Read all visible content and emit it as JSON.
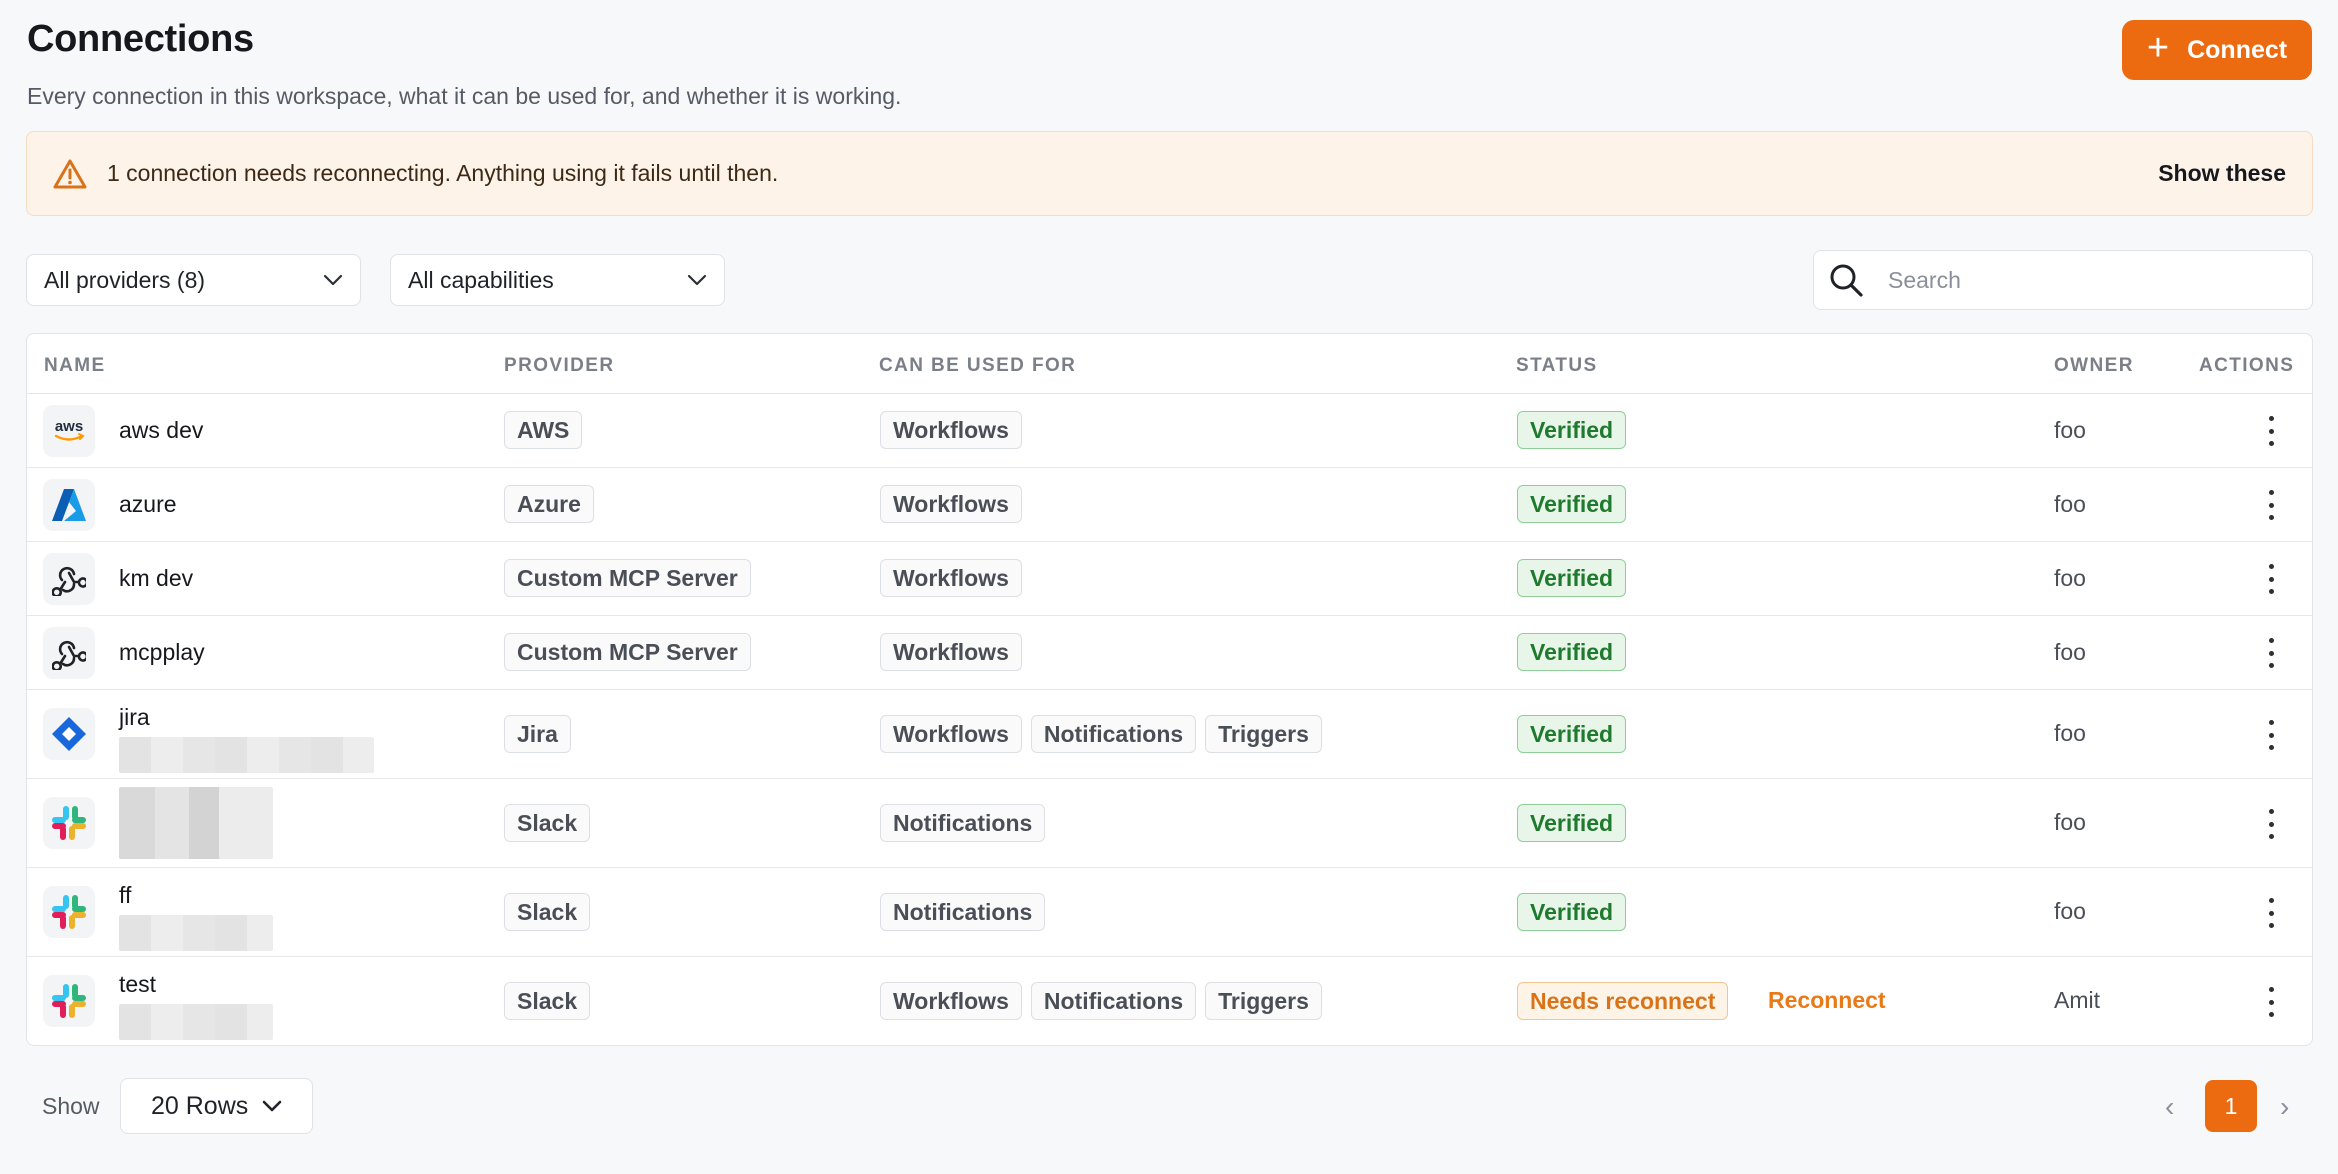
{
  "header": {
    "title": "Connections",
    "subtitle": "Every connection in this workspace, what it can be used for, and whether it is working.",
    "connect_label": "Connect"
  },
  "banner": {
    "text": "1 connection needs reconnecting. Anything using it fails until then.",
    "action_label": "Show these"
  },
  "filters": {
    "providers_selected": "All providers (8)",
    "capabilities_selected": "All capabilities",
    "search_placeholder": "Search"
  },
  "table": {
    "columns": [
      "NAME",
      "PROVIDER",
      "CAN BE USED FOR",
      "STATUS",
      "OWNER",
      "ACTIONS"
    ],
    "rows": [
      {
        "logo": "aws-logo",
        "name": "aws dev",
        "provider": "AWS",
        "capabilities": [
          "Workflows"
        ],
        "status": "Verified",
        "owner": "foo"
      },
      {
        "logo": "azure-logo",
        "name": "azure",
        "provider": "Azure",
        "capabilities": [
          "Workflows"
        ],
        "status": "Verified",
        "owner": "foo"
      },
      {
        "logo": "mcp-logo",
        "name": "km dev",
        "provider": "Custom MCP Server",
        "capabilities": [
          "Workflows"
        ],
        "status": "Verified",
        "owner": "foo"
      },
      {
        "logo": "mcp-logo",
        "name": "mcpplay",
        "provider": "Custom MCP Server",
        "capabilities": [
          "Workflows"
        ],
        "status": "Verified",
        "owner": "foo"
      },
      {
        "logo": "jira-logo",
        "name": "jira",
        "provider": "Jira",
        "capabilities": [
          "Workflows",
          "Notifications",
          "Triggers"
        ],
        "status": "Verified",
        "owner": "foo"
      },
      {
        "logo": "slack-logo",
        "name": "",
        "provider": "Slack",
        "capabilities": [
          "Notifications"
        ],
        "status": "Verified",
        "owner": "foo"
      },
      {
        "logo": "slack-logo",
        "name": "ff",
        "provider": "Slack",
        "capabilities": [
          "Notifications"
        ],
        "status": "Verified",
        "owner": "foo"
      },
      {
        "logo": "slack-logo",
        "name": "test",
        "provider": "Slack",
        "capabilities": [
          "Workflows",
          "Notifications",
          "Triggers"
        ],
        "status": "Needs reconnect",
        "action_link": "Reconnect",
        "owner": "Amit"
      }
    ]
  },
  "footer": {
    "show_label": "Show",
    "rows_selected": "20 Rows",
    "current_page": "1"
  },
  "colors": {
    "accent": "#ec6a10",
    "verified_text": "#1f7a2e",
    "verified_bg": "#e8f6e9",
    "reconnect_text": "#d9731a",
    "banner_bg": "#fdf3e8"
  }
}
